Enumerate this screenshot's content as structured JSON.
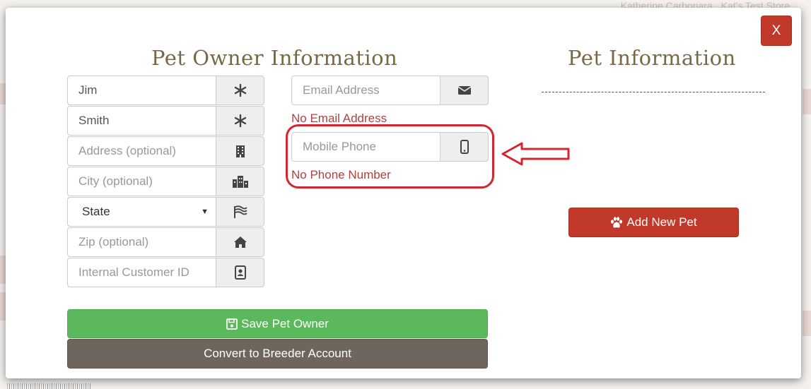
{
  "background": {
    "header_text": [
      "Katherine Carbonara",
      "Kat's Test Store"
    ]
  },
  "modal": {
    "close_label": "X",
    "owner_title": "Pet Owner Information",
    "pet_title": "Pet Information",
    "owner_fields": {
      "first_name": {
        "value": "Jim",
        "icon": "asterisk-icon"
      },
      "last_name": {
        "value": "Smith",
        "icon": "asterisk-icon"
      },
      "address": {
        "placeholder": "Address (optional)",
        "icon": "building-icon"
      },
      "city": {
        "placeholder": "City (optional)",
        "icon": "city-icon"
      },
      "state": {
        "selected": "State",
        "icon": "flag-icon"
      },
      "zip": {
        "placeholder": "Zip (optional)",
        "icon": "home-icon"
      },
      "customer_id": {
        "placeholder": "Internal Customer ID",
        "icon": "id-card-icon"
      }
    },
    "contact": {
      "email": {
        "placeholder": "Email Address",
        "icon": "envelope-icon",
        "error": "No Email Address"
      },
      "phone": {
        "placeholder": "Mobile Phone",
        "icon": "mobile-icon",
        "error": "No Phone Number"
      }
    },
    "buttons": {
      "save": "Save Pet Owner",
      "convert": "Convert to Breeder Account",
      "add_pet": "Add New Pet"
    }
  },
  "colors": {
    "title": "#7a6744",
    "error": "#a94442",
    "save": "#5cb85c",
    "convert": "#6e665e",
    "accent_red": "#c0392b",
    "annotation": "#d32630"
  }
}
